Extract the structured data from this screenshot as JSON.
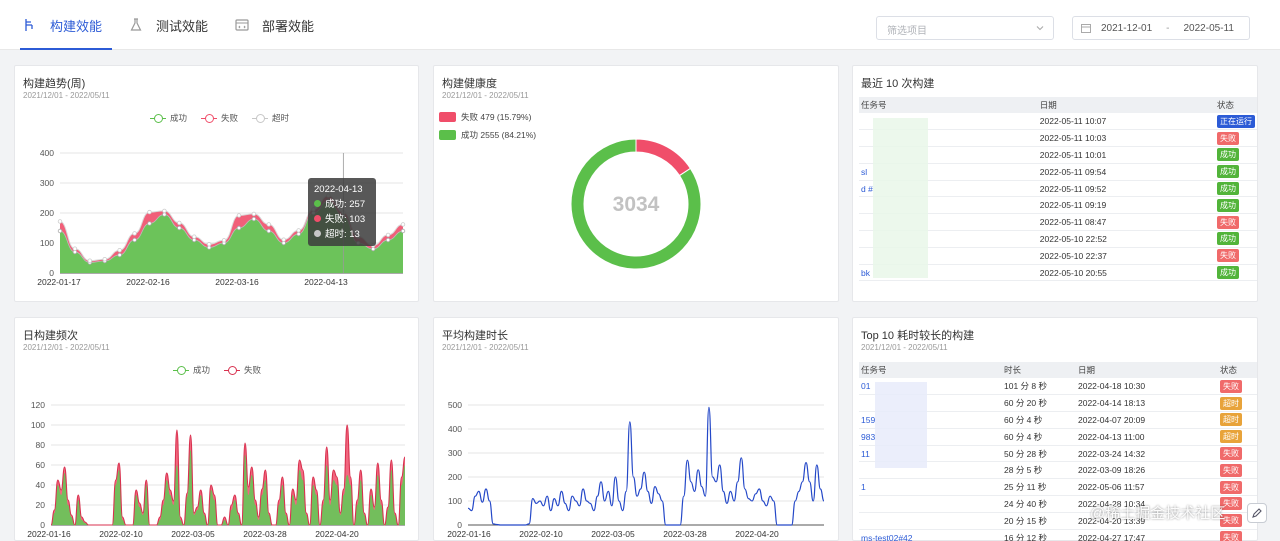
{
  "tabs": [
    {
      "label": "构建效能",
      "icon": "branch-icon",
      "active": true
    },
    {
      "label": "测试效能",
      "icon": "flask-icon",
      "active": false
    },
    {
      "label": "部署效能",
      "icon": "deploy-icon",
      "active": false
    }
  ],
  "filter": {
    "placeholder": "筛选项目"
  },
  "date_range": {
    "start": "2021-12-01",
    "separator": "-",
    "end": "2022-05-11"
  },
  "colors": {
    "success": "#5bbf4a",
    "fail": "#f04e6a",
    "timeout": "#c7c7c7",
    "line_blue": "#2448c8",
    "accent": "#2c5bd6"
  },
  "cards": {
    "trend": {
      "title": "构建趋势(周)",
      "subtitle": "2021/12/01 - 2022/05/11",
      "legend": [
        "成功",
        "失败",
        "超时"
      ],
      "tooltip": {
        "date": "2022-04-13",
        "rows": [
          {
            "label": "成功: 257",
            "color": "#5bbf4a"
          },
          {
            "label": "失败: 103",
            "color": "#f04e6a"
          },
          {
            "label": "超时: 13",
            "color": "#c7c7c7"
          }
        ]
      }
    },
    "health": {
      "title": "构建健康度",
      "subtitle": "2021/12/01 - 2022/05/11",
      "legend": [
        {
          "label": "失败 479 (15.79%)",
          "color": "#f04e6a"
        },
        {
          "label": "成功 2555 (84.21%)",
          "color": "#5bbf4a"
        }
      ],
      "total": "3034"
    },
    "recent": {
      "title": "最近 10 次构建",
      "columns": [
        "任务号",
        "日期",
        "状态"
      ],
      "rows": [
        {
          "task": "",
          "date": "2022-05-11 10:07",
          "status": "正在运行",
          "color": "#2c5bd6"
        },
        {
          "task": "",
          "date": "2022-05-11 10:03",
          "status": "失败",
          "color": "#f06a6a"
        },
        {
          "task": "",
          "date": "2022-05-11 10:01",
          "status": "成功",
          "color": "#52b43a"
        },
        {
          "task": "sl",
          "date": "2022-05-11 09:54",
          "status": "成功",
          "color": "#52b43a"
        },
        {
          "task": "d #",
          "date": "2022-05-11 09:52",
          "status": "成功",
          "color": "#52b43a"
        },
        {
          "task": "",
          "date": "2022-05-11 09:19",
          "status": "成功",
          "color": "#52b43a"
        },
        {
          "task": "",
          "date": "2022-05-11 08:47",
          "status": "失败",
          "color": "#f06a6a"
        },
        {
          "task": "",
          "date": "2022-05-10 22:52",
          "status": "成功",
          "color": "#52b43a"
        },
        {
          "task": "",
          "date": "2022-05-10 22:37",
          "status": "失败",
          "color": "#f06a6a"
        },
        {
          "task": "bk",
          "date": "2022-05-10 20:55",
          "status": "成功",
          "color": "#52b43a"
        }
      ]
    },
    "daily": {
      "title": "日构建频次",
      "subtitle": "2021/12/01 - 2022/05/11",
      "legend": [
        "成功",
        "失败"
      ]
    },
    "avg": {
      "title": "平均构建时长",
      "subtitle": "2021/12/01 - 2022/05/11"
    },
    "top10": {
      "title": "Top 10 耗时较长的构建",
      "subtitle": "2021/12/01 - 2022/05/11",
      "columns": [
        "任务号",
        "时长",
        "日期",
        "状态"
      ],
      "rows": [
        {
          "task": "01",
          "duration": "101 分 8 秒",
          "date": "2022-04-18 10:30",
          "status": "失败",
          "color": "#f06a6a"
        },
        {
          "task": "",
          "duration": "60 分 20 秒",
          "date": "2022-04-14 18:13",
          "status": "超时",
          "color": "#e8a33a"
        },
        {
          "task": "159",
          "duration": "60 分 4 秒",
          "date": "2022-04-07 20:09",
          "status": "超时",
          "color": "#e8a33a"
        },
        {
          "task": "983",
          "duration": "60 分 4 秒",
          "date": "2022-04-13 11:00",
          "status": "超时",
          "color": "#e8a33a"
        },
        {
          "task": "11",
          "duration": "50 分 28 秒",
          "date": "2022-03-24 14:32",
          "status": "失败",
          "color": "#f06a6a"
        },
        {
          "task": "",
          "duration": "28 分 5 秒",
          "date": "2022-03-09 18:26",
          "status": "失败",
          "color": "#f06a6a"
        },
        {
          "task": "1",
          "duration": "25 分 11 秒",
          "date": "2022-05-06 11:57",
          "status": "失败",
          "color": "#f06a6a"
        },
        {
          "task": "",
          "duration": "24 分 40 秒",
          "date": "2022-04-28 10:34",
          "status": "失败",
          "color": "#f06a6a"
        },
        {
          "task": "",
          "duration": "20 分 15 秒",
          "date": "2022-04-20 13:39",
          "status": "失败",
          "color": "#f06a6a"
        },
        {
          "task": "ms-test02#42",
          "duration": "16 分 12 秒",
          "date": "2022-04-27 17:47",
          "status": "失败",
          "color": "#f06a6a"
        }
      ]
    }
  },
  "watermark": "@稀土掘金技术社区",
  "chart_data": [
    {
      "type": "area",
      "title": "构建趋势(周)",
      "x": [
        "2021-12-01",
        "2021-12-08",
        "2021-12-15",
        "2021-12-22",
        "2021-12-29",
        "2022-01-05",
        "2022-01-12",
        "2022-01-19",
        "2022-01-26",
        "2022-02-02",
        "2022-02-09",
        "2022-02-16",
        "2022-02-23",
        "2022-03-02",
        "2022-03-09",
        "2022-03-16",
        "2022-03-23",
        "2022-03-30",
        "2022-04-06",
        "2022-04-13",
        "2022-04-20",
        "2022-04-27",
        "2022-05-04",
        "2022-05-11"
      ],
      "xticks": [
        "2022-01-17",
        "2022-02-16",
        "2022-03-16",
        "2022-04-13"
      ],
      "ylim": [
        0,
        400
      ],
      "yticks": [
        0,
        100,
        200,
        300,
        400
      ],
      "series": [
        {
          "name": "成功",
          "values": [
            140,
            70,
            35,
            40,
            60,
            110,
            165,
            195,
            150,
            110,
            85,
            100,
            150,
            180,
            140,
            100,
            130,
            200,
            240,
            190,
            100,
            80,
            110,
            140
          ]
        },
        {
          "name": "失败",
          "values": [
            30,
            10,
            5,
            5,
            15,
            20,
            35,
            10,
            15,
            10,
            10,
            8,
            40,
            15,
            20,
            10,
            10,
            10,
            15,
            10,
            20,
            10,
            15,
            20
          ]
        },
        {
          "name": "超时",
          "values": [
            2,
            1,
            1,
            1,
            1,
            2,
            3,
            2,
            2,
            1,
            1,
            1,
            2,
            2,
            2,
            1,
            2,
            2,
            3,
            2,
            2,
            2,
            2,
            2
          ]
        }
      ]
    },
    {
      "type": "pie",
      "title": "构建健康度",
      "center_label": "3034",
      "slices": [
        {
          "name": "失败",
          "value": 479
        },
        {
          "name": "成功",
          "value": 2555
        }
      ]
    },
    {
      "type": "area",
      "title": "日构建频次",
      "xticks": [
        "2022-01-16",
        "2022-02-10",
        "2022-03-05",
        "2022-03-28",
        "2022-04-20"
      ],
      "ylim": [
        0,
        120
      ],
      "yticks": [
        0,
        20,
        40,
        60,
        80,
        100,
        120
      ],
      "series": [
        {
          "name": "成功",
          "values": [
            0,
            12,
            40,
            30,
            52,
            20,
            8,
            0,
            25,
            5,
            2,
            0,
            0,
            0,
            0,
            0,
            0,
            0,
            0,
            40,
            55,
            5,
            0,
            0,
            0,
            30,
            18,
            10,
            40,
            0,
            0,
            0,
            5,
            20,
            45,
            30,
            20,
            60,
            5,
            0,
            28,
            75,
            10,
            15,
            30,
            10,
            0,
            35,
            25,
            0,
            0,
            5,
            0,
            15,
            25,
            10,
            0,
            70,
            30,
            50,
            20,
            5,
            30,
            45,
            10,
            0,
            0,
            20,
            40,
            10,
            0,
            30,
            20,
            55,
            45,
            10,
            0,
            40,
            30,
            0,
            20,
            60,
            20,
            45,
            40,
            10,
            30,
            50,
            40,
            0,
            20,
            45,
            10,
            0,
            30,
            15,
            50,
            20,
            0,
            15,
            55,
            10,
            0,
            40,
            60
          ]
        },
        {
          "name": "失败",
          "values": [
            0,
            15,
            45,
            35,
            58,
            25,
            10,
            0,
            30,
            8,
            3,
            0,
            0,
            0,
            0,
            0,
            0,
            0,
            0,
            45,
            62,
            8,
            0,
            0,
            0,
            35,
            22,
            12,
            45,
            0,
            0,
            0,
            8,
            25,
            52,
            35,
            24,
            95,
            8,
            0,
            32,
            90,
            12,
            18,
            35,
            12,
            0,
            40,
            30,
            0,
            0,
            8,
            0,
            20,
            30,
            12,
            0,
            82,
            38,
            58,
            25,
            8,
            36,
            55,
            12,
            0,
            0,
            25,
            48,
            12,
            0,
            36,
            25,
            65,
            55,
            12,
            0,
            48,
            35,
            0,
            25,
            78,
            25,
            55,
            48,
            12,
            36,
            100,
            48,
            0,
            25,
            55,
            12,
            0,
            36,
            18,
            62,
            25,
            0,
            18,
            65,
            12,
            0,
            48,
            68
          ]
        }
      ]
    },
    {
      "type": "line",
      "title": "平均构建时长",
      "xticks": [
        "2022-01-16",
        "2022-02-10",
        "2022-03-05",
        "2022-03-28",
        "2022-04-20"
      ],
      "ylim": [
        0,
        500
      ],
      "yticks": [
        0,
        100,
        200,
        300,
        400,
        500
      ],
      "series": [
        {
          "name": "平均构建时长",
          "values": [
            70,
            60,
            120,
            140,
            95,
            150,
            100,
            5,
            2,
            0,
            0,
            0,
            0,
            0,
            0,
            0,
            0,
            5,
            110,
            90,
            100,
            80,
            120,
            60,
            110,
            80,
            140,
            90,
            60,
            120,
            100,
            80,
            150,
            100,
            90,
            60,
            120,
            180,
            100,
            140,
            80,
            200,
            100,
            60,
            140,
            430,
            200,
            120,
            150,
            220,
            140,
            90,
            160,
            130,
            100,
            0,
            0,
            0,
            0,
            0,
            120,
            270,
            180,
            140,
            230,
            160,
            120,
            490,
            200,
            180,
            250,
            140,
            90,
            140,
            100,
            180,
            280,
            150,
            110,
            100,
            130,
            150,
            100,
            80,
            120,
            100,
            0,
            0,
            0,
            0,
            0,
            100,
            140,
            180,
            260,
            180,
            100,
            250,
            150,
            100
          ]
        }
      ]
    }
  ]
}
